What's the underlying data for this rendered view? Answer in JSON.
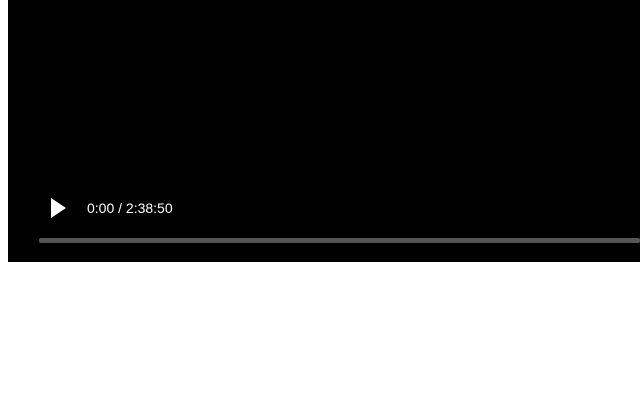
{
  "player": {
    "play_icon": "play-icon",
    "current_time": "0:00",
    "time_separator": " / ",
    "duration": "2:38:50",
    "progress_fraction": 0,
    "colors": {
      "background": "#000000",
      "text": "#ffffff",
      "track": "#555555"
    }
  }
}
